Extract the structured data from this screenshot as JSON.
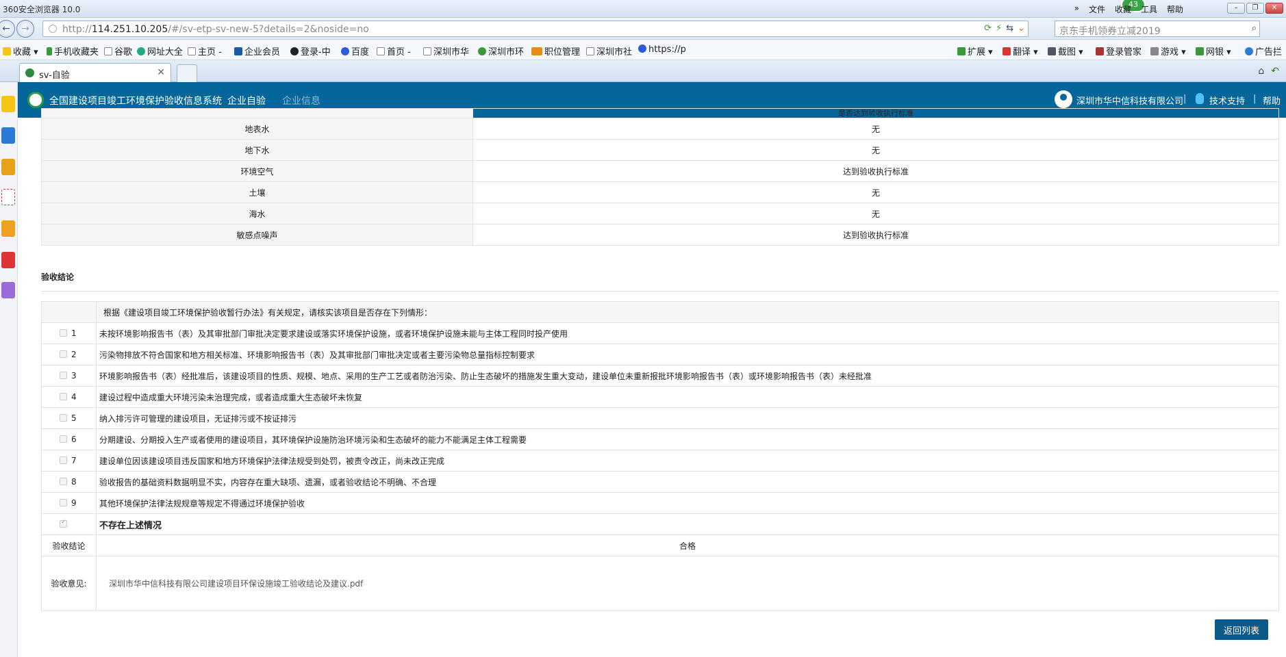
{
  "browser": {
    "title": "360安全浏览器 10.0",
    "menus": [
      "»",
      "文件",
      "收藏",
      "工具",
      "帮助"
    ],
    "badge": "43",
    "url_prefix": "http://",
    "url_host": "114.251.10.205",
    "url_rest": "/#/sv-etp-sv-new-5?details=2&noside=no",
    "search_placeholder": "京东手机领券立减2019",
    "bookmarks": [
      "收藏",
      "手机收藏夹",
      "谷歌",
      "网址大全",
      "主页 -",
      "企业会员",
      "登录-中",
      "百度",
      "首页 -",
      "深圳市华",
      "深圳市环",
      "职位管理",
      "深圳市社",
      "https://p"
    ],
    "bookmarks_right": [
      "扩展",
      "翻译",
      "截图",
      "登录管家",
      "游戏",
      "网银",
      "广告拦"
    ],
    "tab_label": "sv-自验"
  },
  "header": {
    "system_name": "全国建设项目竣工环境保护验收信息系统",
    "nav_self_check": "企业自验",
    "nav_enterprise_info": "企业信息",
    "company": "深圳市华中信科技有限公司",
    "separator": "|",
    "tech_support": "技术支持",
    "help": "帮助"
  },
  "env_rows": [
    {
      "item": "",
      "value": "是否达到验收执行标准"
    },
    {
      "item": "地表水",
      "value": "无"
    },
    {
      "item": "地下水",
      "value": "无"
    },
    {
      "item": "环境空气",
      "value": "达到验收执行标准"
    },
    {
      "item": "土壤",
      "value": "无"
    },
    {
      "item": "海水",
      "value": "无"
    },
    {
      "item": "敏感点噪声",
      "value": "达到验收执行标准"
    }
  ],
  "conclusion": {
    "section_title": "验收结论",
    "intro": "根据《建设项目竣工环境保护验收暂行办法》有关规定，请核实该项目是否存在下列情形：",
    "items": [
      {
        "num": "1",
        "text": "未按环境影响报告书（表）及其审批部门审批决定要求建设或落实环境保护设施，或者环境保护设施未能与主体工程同时投产使用"
      },
      {
        "num": "2",
        "text": "污染物排放不符合国家和地方相关标准、环境影响报告书（表）及其审批部门审批决定或者主要污染物总量指标控制要求"
      },
      {
        "num": "3",
        "text": "环境影响报告书（表）经批准后，该建设项目的性质、规模、地点、采用的生产工艺或者防治污染、防止生态破坏的措施发生重大变动，建设单位未重新报批环境影响报告书（表）或环境影响报告书（表）未经批准"
      },
      {
        "num": "4",
        "text": "建设过程中造成重大环境污染未治理完成，或者造成重大生态破坏未恢复"
      },
      {
        "num": "5",
        "text": "纳入排污许可管理的建设项目，无证排污或不按证排污"
      },
      {
        "num": "6",
        "text": "分期建设、分期投入生产或者使用的建设项目，其环境保护设施防治环境污染和生态破坏的能力不能满足主体工程需要"
      },
      {
        "num": "7",
        "text": "建设单位因该建设项目违反国家和地方环境保护法律法规受到处罚，被责令改正，尚未改正完成"
      },
      {
        "num": "8",
        "text": "验收报告的基础资料数据明显不实，内容存在重大缺项、遗漏，或者验收结论不明确、不合理"
      },
      {
        "num": "9",
        "text": "其他环境保护法律法规规章等规定不得通过环境保护验收"
      }
    ],
    "none_label": "不存在上述情况",
    "result_label": "验收结论",
    "result_value": "合格",
    "opinion_label": "验收意见:",
    "opinion_file": "深圳市华中信科技有限公司建设项目环保设施竣工验收结论及建议.pdf",
    "back_button": "返回列表"
  }
}
